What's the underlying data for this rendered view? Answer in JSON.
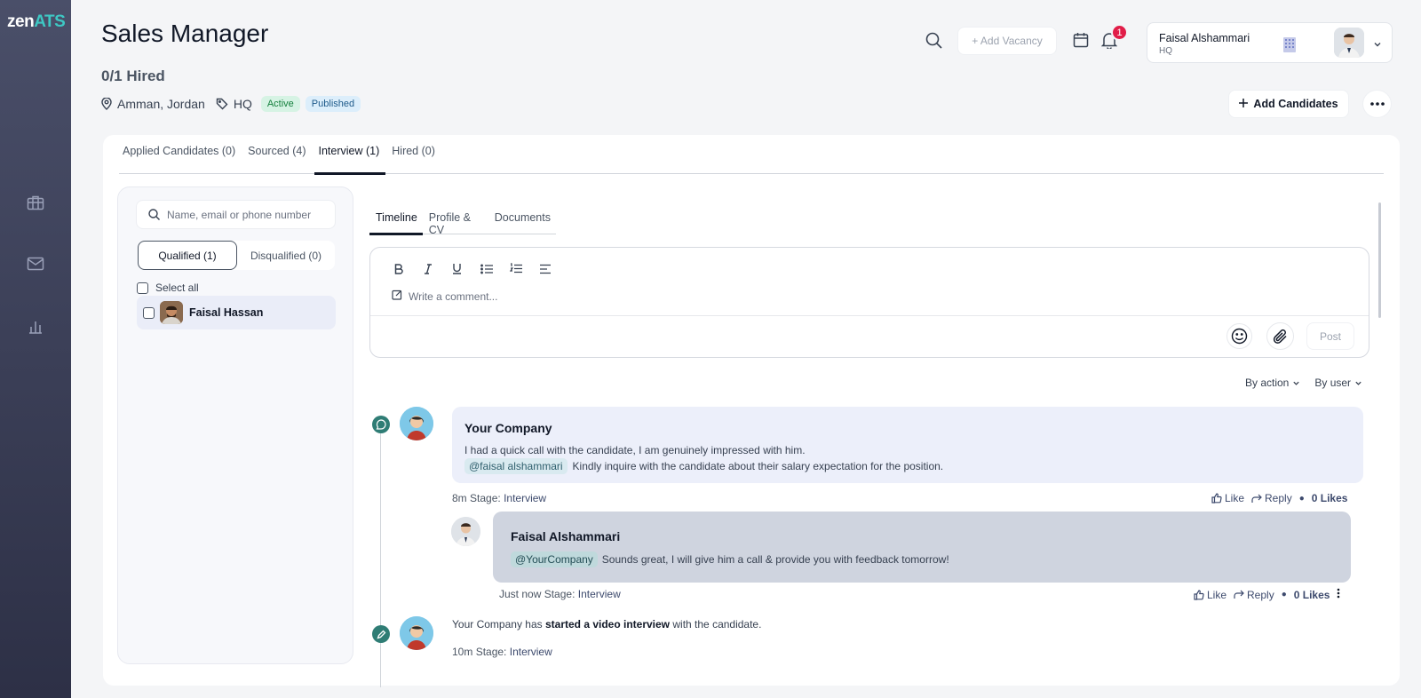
{
  "app": {
    "logo_part1": "zen",
    "logo_part2": "ATS"
  },
  "sidebar": {
    "items": [
      {
        "name": "briefcase-icon"
      },
      {
        "name": "mail-icon"
      },
      {
        "name": "chart-icon"
      }
    ]
  },
  "header": {
    "title": "Sales Manager",
    "hired": "0/1 Hired",
    "location": "Amman, Jordan",
    "tag": "HQ",
    "badge_active": "Active",
    "badge_published": "Published",
    "add_vacancy": "+ Add Vacancy",
    "notifications": "1",
    "user_name": "Faisal Alshammari",
    "user_org": "HQ",
    "add_candidates": "Add Candidates"
  },
  "tabs": [
    {
      "label": "Applied Candidates (0)"
    },
    {
      "label": "Sourced (4)"
    },
    {
      "label": "Interview (1)",
      "active": true
    },
    {
      "label": "Hired (0)"
    }
  ],
  "left_panel": {
    "search_placeholder": "Name, email or phone number",
    "qualified": "Qualified (1)",
    "disqualified": "Disqualified (0)",
    "select_all": "Select all",
    "candidates": [
      {
        "name": "Faisal Hassan"
      }
    ]
  },
  "sub_tabs": [
    {
      "label": "Timeline",
      "active": true
    },
    {
      "label": "Profile & CV"
    },
    {
      "label": "Documents"
    }
  ],
  "editor": {
    "placeholder": "Write a comment...",
    "post": "Post"
  },
  "filters": {
    "by_action": "By action",
    "by_user": "By user"
  },
  "timeline": {
    "comment": {
      "author": "Your Company",
      "line1": "I had a quick call with the candidate, I am genuinely impressed with him.",
      "mention": "@faisal alshammari",
      "line2": "Kindly inquire with the candidate about their salary expectation for the position.",
      "time": "8m",
      "stage_label": "Stage:",
      "stage": "Interview",
      "like": "Like",
      "reply": "Reply",
      "likes": "0 Likes"
    },
    "reply": {
      "author": "Faisal Alshammari",
      "mention": "@YourCompany",
      "text": "Sounds great, I will give him a call & provide you with feedback tomorrow!",
      "time": "Just now",
      "stage_label": "Stage:",
      "stage": "Interview",
      "like": "Like",
      "reply": "Reply",
      "likes": "0 Likes"
    },
    "event": {
      "prefix": "Your Company has",
      "action": "started a video interview",
      "suffix": "with the candidate.",
      "time": "10m",
      "stage_label": "Stage:",
      "stage": "Interview"
    }
  },
  "colors": {
    "sidebar": "#3a3e55",
    "accent": "#3ec8c4",
    "timeline_dot": "#2f7d75",
    "notification": "#e11d48"
  }
}
